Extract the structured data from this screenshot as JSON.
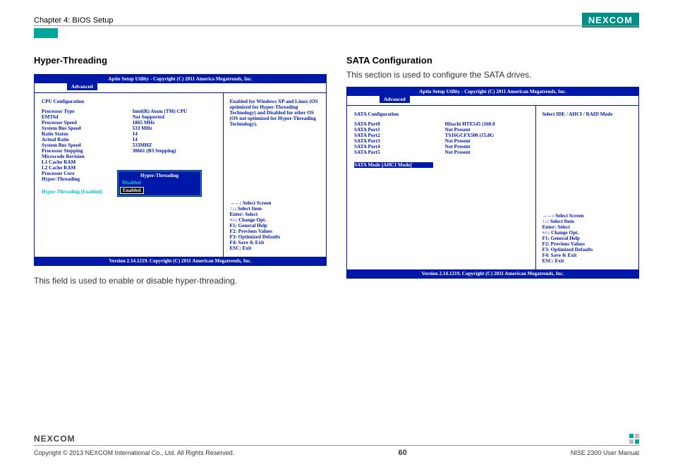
{
  "header": {
    "chapter": "Chapter 4: BIOS Setup",
    "brand": "NE",
    "brand_x": "X",
    "brand2": "COM"
  },
  "left": {
    "title": "Hyper-Threading",
    "caption": "This field is used to enable or disable hyper-threading.",
    "bios": {
      "top": "Aptio Setup Utility - Copyright (C) 2011 America Megatrends, Inc.",
      "tab": "Advanced",
      "section": "CPU Configuration",
      "rows": [
        {
          "k": "Processor Type",
          "v": "Intel(R) Atom (TM) CPU"
        },
        {
          "k": "EMT64",
          "v": "Not Supported"
        },
        {
          "k": "Processor Speed",
          "v": "1865 MHz"
        },
        {
          "k": "System Bus Speed",
          "v": "533 MHz"
        },
        {
          "k": "Ratio Status",
          "v": "14"
        },
        {
          "k": "Actual Ratio",
          "v": "14"
        },
        {
          "k": "System Bus Speed",
          "v": "533MHZ"
        },
        {
          "k": "Processor Stepping",
          "v": "30661 (B3 Stepping)"
        },
        {
          "k": "Microcode Revision",
          "v": ""
        },
        {
          "k": "L1 Cache RAM",
          "v": ""
        },
        {
          "k": "L2 Cache RAM",
          "v": ""
        },
        {
          "k": "Processor Core",
          "v": ""
        },
        {
          "k": "Hyper-Threading",
          "v": ""
        }
      ],
      "selected_row": {
        "k": "Hyper-Threading",
        "v": "[Enabled]"
      },
      "popup_title": "Hyper-Threading",
      "popup_disabled": "Disabled",
      "popup_enabled": "Enabled",
      "help_top": "Enabled for Windows XP and Linux (OS optimized for Hyper-Threading Technology) and Disabled for other OS (OS not optimized for Hyper-Threading Technology).",
      "help_keys": [
        "→←: Select Screen",
        "↑↓: Select Item",
        "Enter: Select",
        "+/-: Change Opt.",
        "F1: General Help",
        "F2: Previous Values",
        "F3: Optimized Defaults",
        "F4: Save & Exit",
        "ESC: Exit"
      ],
      "version": "Version 2.14.1219. Copyright (C) 2011 American Megatrends, Inc."
    }
  },
  "right": {
    "title": "SATA Configuration",
    "desc": "This section is used to configure the SATA drives.",
    "bios": {
      "top": "Aptio Setup Utility - Copyright (C) 2011 American Megatrends, Inc.",
      "tab": "Advanced",
      "section": "SATA Configuration",
      "rows": [
        {
          "k": "SATA Port0",
          "v": "Hitachi HTE545 (160.0"
        },
        {
          "k": "SATA Port1",
          "v": "Not Present"
        },
        {
          "k": "SATA Port2",
          "v": "TS16GCFX500   (15.8G"
        },
        {
          "k": "SATA Port3",
          "v": "Not Present"
        },
        {
          "k": "SATA Port4",
          "v": "Not Present"
        },
        {
          "k": "SATA Port5",
          "v": "Not Present"
        }
      ],
      "selected_row": {
        "k": "SATA Mode",
        "v": "[AHCI Mode]"
      },
      "help_top": "Select IDE / AHCI / RAID Mode",
      "help_keys": [
        "→←: Select Screen",
        "↑↓: Select Item",
        "Enter: Select",
        "+/-: Change Opt.",
        "F1: General Help",
        "F2: Previous Values",
        "F3: Optimized Defaults",
        "F4: Save & Exit",
        "ESC: Exit"
      ],
      "version": "Version 2.14.1219. Copyright (C) 2011 American Megatrends, Inc."
    }
  },
  "footer": {
    "copyright": "Copyright © 2013 NEXCOM International Co., Ltd. All Rights Reserved.",
    "page": "60",
    "product": "NISE 2300 User Manual",
    "brand": "NEXCOM"
  }
}
